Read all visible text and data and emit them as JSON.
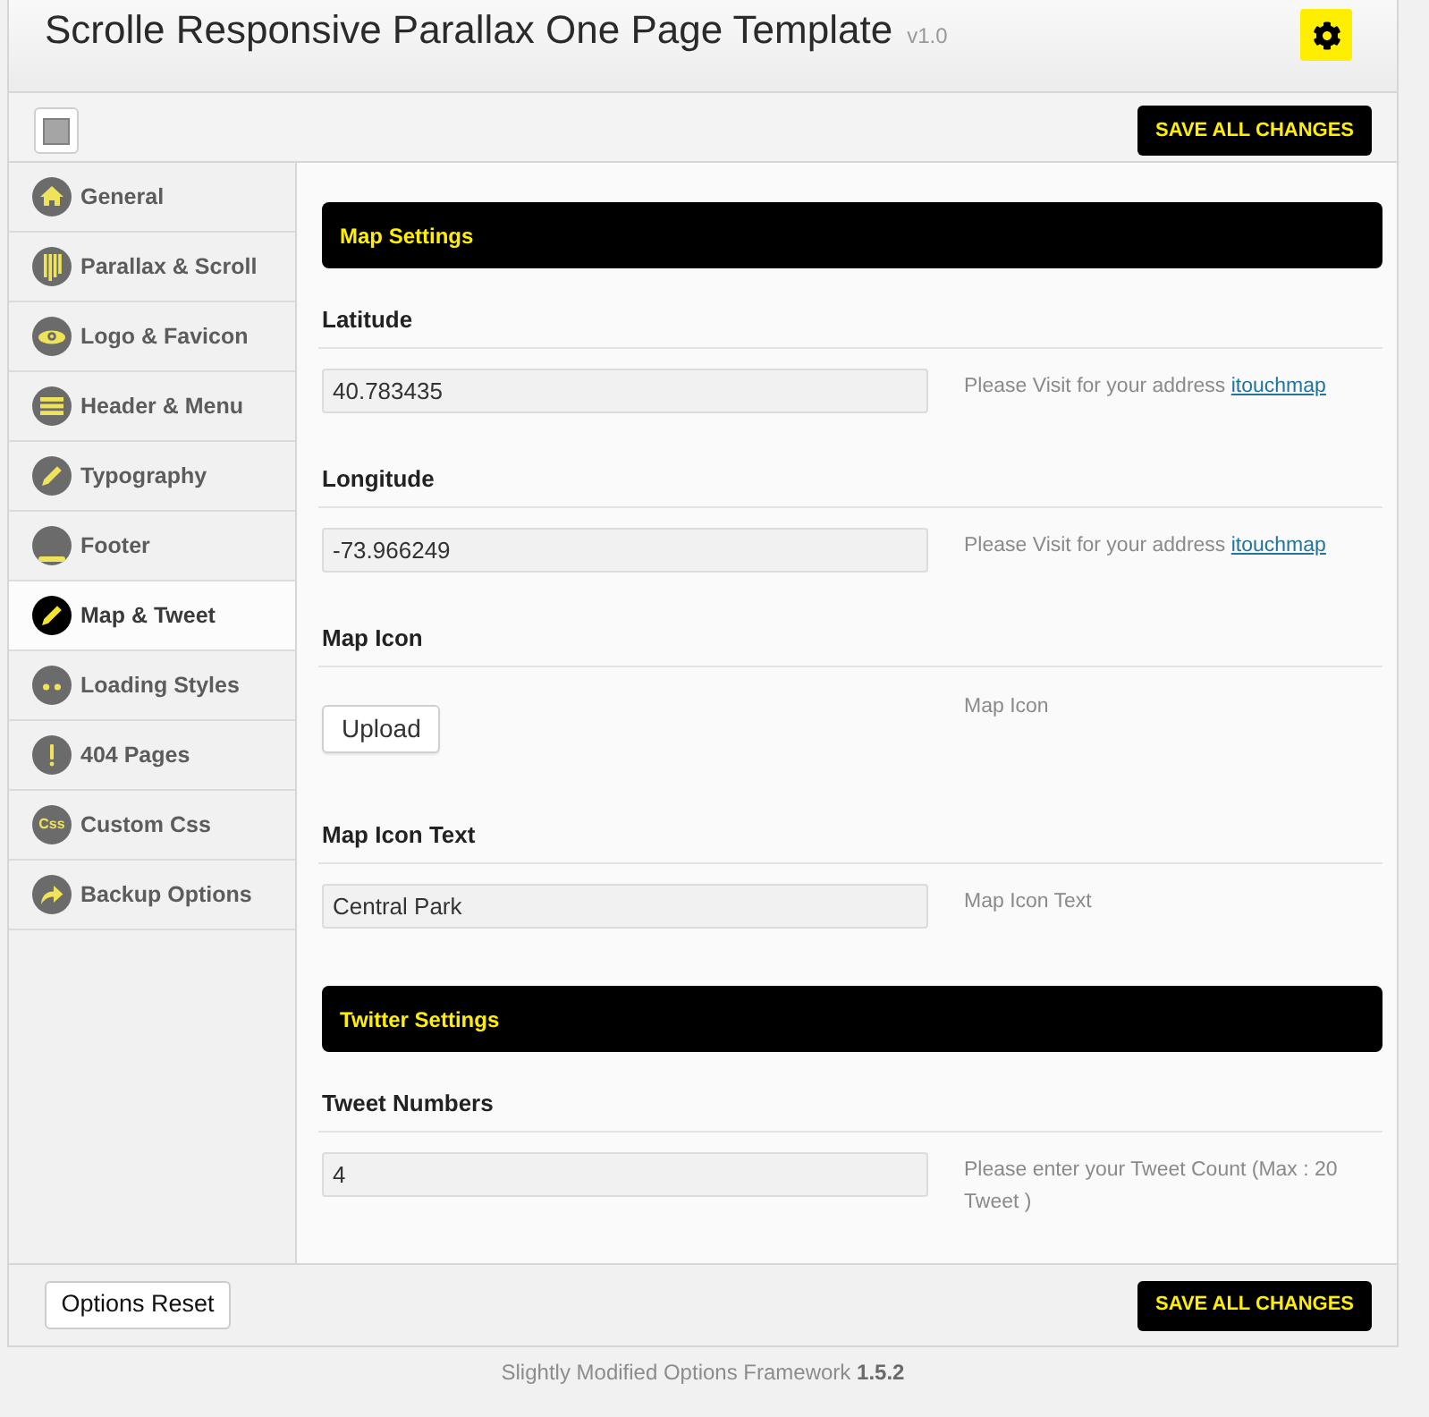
{
  "header": {
    "title": "Scrolle Responsive Parallax One Page Template",
    "version": "v1.0"
  },
  "toolbar": {
    "save_button": "SAVE ALL CHANGES"
  },
  "sidebar": {
    "items": [
      {
        "label": "General",
        "selected": false
      },
      {
        "label": "Parallax & Scroll",
        "selected": false
      },
      {
        "label": "Logo & Favicon",
        "selected": false
      },
      {
        "label": "Header & Menu",
        "selected": false
      },
      {
        "label": "Typography",
        "selected": false
      },
      {
        "label": "Footer",
        "selected": false
      },
      {
        "label": "Map & Tweet",
        "selected": true
      },
      {
        "label": "Loading Styles",
        "selected": false
      },
      {
        "label": "404 Pages",
        "selected": false
      },
      {
        "label": "Custom Css",
        "icon_text": "Css",
        "selected": false
      },
      {
        "label": "Backup Options",
        "selected": false
      }
    ]
  },
  "sections": [
    {
      "title": "Map Settings",
      "fields": [
        {
          "kind": "text",
          "label": "Latitude",
          "value": "40.783435",
          "description": "Please Visit for your address",
          "link": "itouchmap"
        },
        {
          "kind": "text",
          "label": "Longitude",
          "value": "-73.966249",
          "description": "Please Visit for your address",
          "link": "itouchmap"
        },
        {
          "kind": "upload",
          "label": "Map Icon",
          "button": "Upload",
          "description": "Map Icon"
        },
        {
          "kind": "text",
          "label": "Map Icon Text",
          "value": "Central Park",
          "description": "Map Icon Text"
        }
      ]
    },
    {
      "title": "Twitter Settings",
      "fields": [
        {
          "kind": "text",
          "label": "Tweet Numbers",
          "value": "4",
          "description": "Please enter your Tweet Count (Max : 20 Tweet )"
        }
      ]
    }
  ],
  "footer": {
    "reset_button": "Options Reset",
    "save_button": "SAVE ALL CHANGES",
    "credit": "Slightly Modified Options Framework **1.5.2**"
  }
}
